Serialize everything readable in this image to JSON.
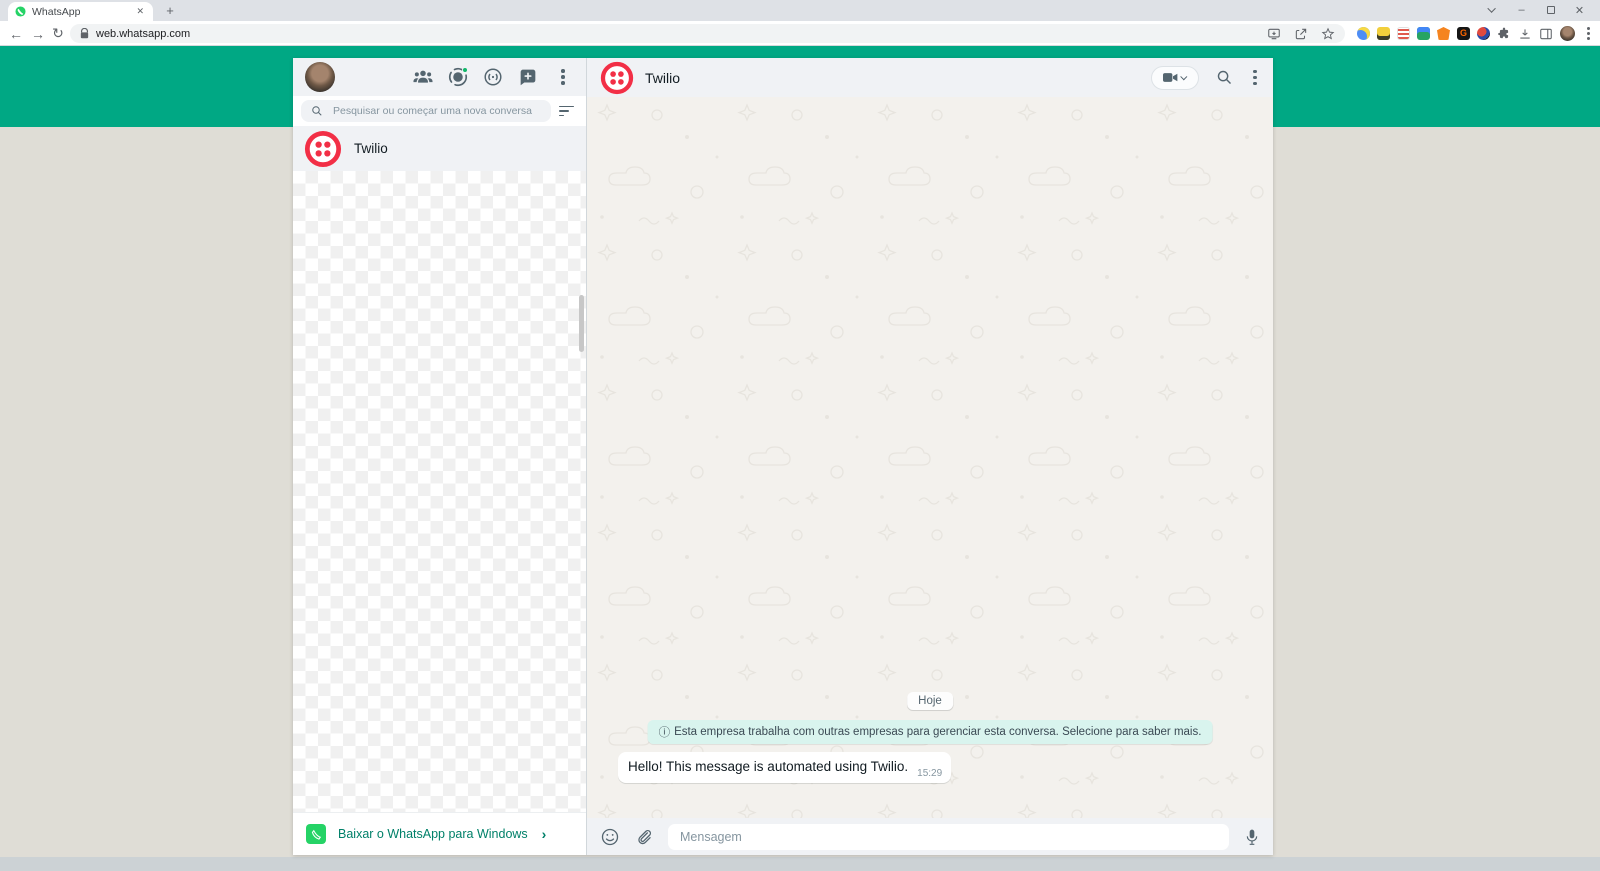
{
  "browser": {
    "tab_title": "WhatsApp",
    "url": "web.whatsapp.com",
    "extensions": [
      {
        "name": "extension-blue-circle",
        "color": "#4e8df5"
      },
      {
        "name": "extension-yellow",
        "color": "#f2cf3c"
      },
      {
        "name": "extension-red-stripes",
        "color": "#e05a4e"
      },
      {
        "name": "extension-green-blue",
        "color": "#27a463"
      },
      {
        "name": "extension-metamask",
        "color": "#f5841f"
      },
      {
        "name": "extension-g",
        "color": "#161616",
        "label": "G"
      },
      {
        "name": "extension-ball",
        "color": "#c63d3d"
      }
    ]
  },
  "sidebar": {
    "search_placeholder": "Pesquisar ou começar uma nova conversa",
    "chats": [
      {
        "name": "Twilio"
      }
    ],
    "download_banner": {
      "label": "Baixar o WhatsApp para Windows",
      "chevron": "›"
    }
  },
  "chat": {
    "title": "Twilio",
    "date_badge": "Hoje",
    "notice": "Esta empresa trabalha com outras empresas para gerenciar esta conversa. Selecione para saber mais.",
    "messages": [
      {
        "text": "Hello! This message is automated using Twilio.",
        "time": "15:29"
      }
    ],
    "input_placeholder": "Mensagem"
  },
  "icons": {
    "close": "✕",
    "plus": "+",
    "minimize": "–",
    "back": "←",
    "forward": "→",
    "reload": "↻",
    "info": "ⓘ",
    "chevron_right": "›"
  },
  "colors": {
    "whatsapp_green": "#00a884",
    "whatsapp_icon_green": "#25d366",
    "twilio_red": "#f22f46",
    "link_teal": "#008069",
    "notice_bg": "#d9f4ee"
  }
}
